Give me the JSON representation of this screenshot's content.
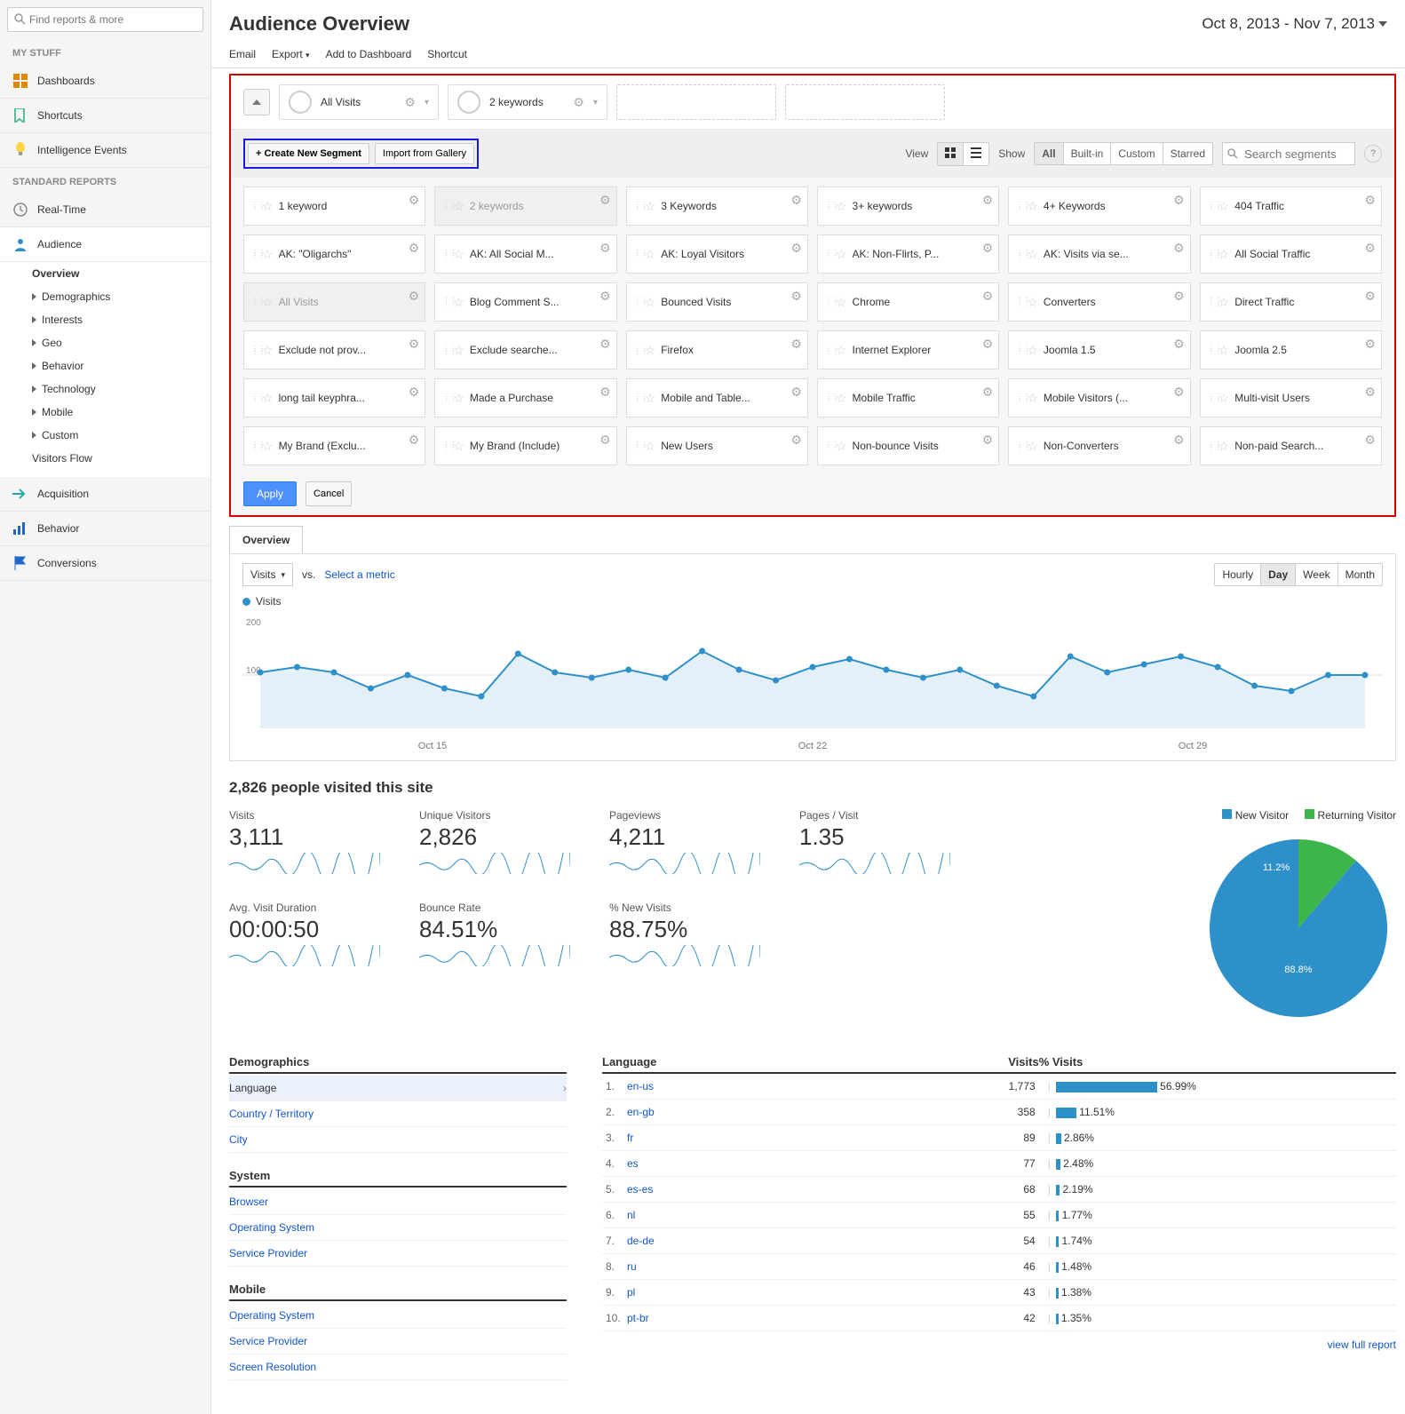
{
  "search_placeholder": "Find reports & more",
  "page_title": "Audience Overview",
  "date_range": "Oct 8, 2013 - Nov 7, 2013",
  "toolbar": [
    "Email",
    "Export",
    "Add to Dashboard",
    "Shortcut"
  ],
  "sidebar": {
    "my_stuff_header": "MY STUFF",
    "my_stuff": [
      "Dashboards",
      "Shortcuts",
      "Intelligence Events"
    ],
    "reports_header": "STANDARD REPORTS",
    "reports": [
      {
        "label": "Real-Time",
        "icon": "clock"
      },
      {
        "label": "Audience",
        "icon": "person",
        "active": true,
        "children": [
          "Overview",
          "Demographics",
          "Interests",
          "Geo",
          "Behavior",
          "Technology",
          "Mobile",
          "Custom",
          "Visitors Flow"
        ]
      },
      {
        "label": "Acquisition",
        "icon": "arrow"
      },
      {
        "label": "Behavior",
        "icon": "bars"
      },
      {
        "label": "Conversions",
        "icon": "flag"
      }
    ]
  },
  "segments": {
    "applied": [
      "All Visits",
      "2 keywords"
    ],
    "create_btn": "+ Create New Segment",
    "import_btn": "Import from Gallery",
    "view_label": "View",
    "show_label": "Show",
    "show_opts": [
      "All",
      "Built-in",
      "Custom",
      "Starred"
    ],
    "search_placeholder": "Search segments",
    "cards": [
      "1 keyword",
      "2 keywords",
      "3 Keywords",
      "3+ keywords",
      "4+ Keywords",
      "404 Traffic",
      "AK: \"Oligarchs\"",
      "AK: All Social M...",
      "AK: Loyal Visitors",
      "AK: Non-Flirts, P...",
      "AK: Visits via se...",
      "All Social Traffic",
      "All Visits",
      "Blog Comment S...",
      "Bounced Visits",
      "Chrome",
      "Converters",
      "Direct Traffic",
      "Exclude not prov...",
      "Exclude searche...",
      "Firefox",
      "Internet Explorer",
      "Joomla 1.5",
      "Joomla 2.5",
      "long tail keyphra...",
      "Made a Purchase",
      "Mobile and Table...",
      "Mobile Traffic",
      "Mobile Visitors (...",
      "Multi-visit Users",
      "My Brand (Exclu...",
      "My Brand (Include)",
      "New Users",
      "Non-bounce Visits",
      "Non-Converters",
      "Non-paid Search..."
    ],
    "dimmed": [
      1,
      12
    ],
    "apply": "Apply",
    "cancel": "Cancel"
  },
  "overview_tab": "Overview",
  "chart": {
    "metric": "Visits",
    "vs": "vs.",
    "select": "Select a metric",
    "time_opts": [
      "Hourly",
      "Day",
      "Week",
      "Month"
    ],
    "time_active": "Day",
    "ylabels": [
      "200",
      "100"
    ],
    "xlabels": [
      "Oct 15",
      "Oct 22",
      "Oct 29"
    ]
  },
  "chart_data": {
    "type": "line",
    "title": "Visits",
    "xlabel": "",
    "ylabel": "",
    "ylim": [
      0,
      200
    ],
    "x": [
      "Oct 8",
      "Oct 9",
      "Oct 10",
      "Oct 11",
      "Oct 12",
      "Oct 13",
      "Oct 14",
      "Oct 15",
      "Oct 16",
      "Oct 17",
      "Oct 18",
      "Oct 19",
      "Oct 20",
      "Oct 21",
      "Oct 22",
      "Oct 23",
      "Oct 24",
      "Oct 25",
      "Oct 26",
      "Oct 27",
      "Oct 28",
      "Oct 29",
      "Oct 30",
      "Oct 31",
      "Nov 1",
      "Nov 2",
      "Nov 3",
      "Nov 4",
      "Nov 5",
      "Nov 6",
      "Nov 7"
    ],
    "series": [
      {
        "name": "Visits",
        "values": [
          105,
          115,
          105,
          75,
          100,
          75,
          60,
          140,
          105,
          95,
          110,
          95,
          145,
          110,
          90,
          115,
          130,
          110,
          95,
          110,
          80,
          60,
          135,
          105,
          120,
          135,
          115,
          80,
          70,
          100,
          100
        ]
      }
    ]
  },
  "summary_headline": "2,826 people visited this site",
  "metrics": [
    {
      "label": "Visits",
      "value": "3,111"
    },
    {
      "label": "Unique Visitors",
      "value": "2,826"
    },
    {
      "label": "Pageviews",
      "value": "4,211"
    },
    {
      "label": "Pages / Visit",
      "value": "1.35"
    },
    {
      "label": "Avg. Visit Duration",
      "value": "00:00:50"
    },
    {
      "label": "Bounce Rate",
      "value": "84.51%"
    },
    {
      "label": "% New Visits",
      "value": "88.75%"
    }
  ],
  "pie": {
    "legend": [
      "New Visitor",
      "Returning Visitor"
    ],
    "values": [
      88.8,
      11.2
    ],
    "colors": [
      "#2e90c9",
      "#3db54a"
    ]
  },
  "dim_groups": [
    {
      "title": "Demographics",
      "rows": [
        "Language",
        "Country / Territory",
        "City"
      ],
      "selected": 0
    },
    {
      "title": "System",
      "rows": [
        "Browser",
        "Operating System",
        "Service Provider"
      ]
    },
    {
      "title": "Mobile",
      "rows": [
        "Operating System",
        "Service Provider",
        "Screen Resolution"
      ]
    }
  ],
  "lang_table": {
    "headers": [
      "Language",
      "Visits",
      "% Visits"
    ],
    "rows": [
      {
        "n": 1,
        "lang": "en-us",
        "visits": "1,773",
        "pct": "56.99%",
        "bar": 57
      },
      {
        "n": 2,
        "lang": "en-gb",
        "visits": "358",
        "pct": "11.51%",
        "bar": 11.5
      },
      {
        "n": 3,
        "lang": "fr",
        "visits": "89",
        "pct": "2.86%",
        "bar": 2.9
      },
      {
        "n": 4,
        "lang": "es",
        "visits": "77",
        "pct": "2.48%",
        "bar": 2.5
      },
      {
        "n": 5,
        "lang": "es-es",
        "visits": "68",
        "pct": "2.19%",
        "bar": 2.2
      },
      {
        "n": 6,
        "lang": "nl",
        "visits": "55",
        "pct": "1.77%",
        "bar": 1.8
      },
      {
        "n": 7,
        "lang": "de-de",
        "visits": "54",
        "pct": "1.74%",
        "bar": 1.7
      },
      {
        "n": 8,
        "lang": "ru",
        "visits": "46",
        "pct": "1.48%",
        "bar": 1.5
      },
      {
        "n": 9,
        "lang": "pl",
        "visits": "43",
        "pct": "1.38%",
        "bar": 1.4
      },
      {
        "n": 10,
        "lang": "pt-br",
        "visits": "42",
        "pct": "1.35%",
        "bar": 1.35
      }
    ],
    "full_report": "view full report"
  }
}
